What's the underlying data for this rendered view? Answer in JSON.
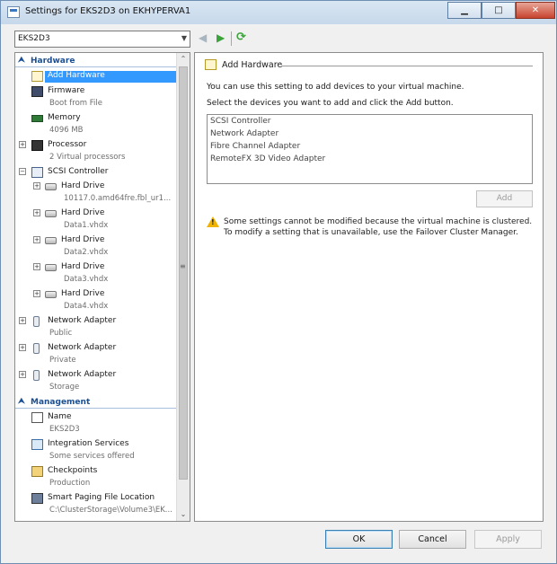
{
  "window": {
    "title": "Settings for EKS2D3 on EKHYPERVA1"
  },
  "vm_selector": {
    "value": "EKS2D3"
  },
  "tree": {
    "hardware_header": "Hardware",
    "hardware": [
      {
        "label": "Add Hardware",
        "sub": ""
      },
      {
        "label": "Firmware",
        "sub": "Boot from File"
      },
      {
        "label": "Memory",
        "sub": "4096 MB"
      },
      {
        "label": "Processor",
        "sub": "2 Virtual processors"
      },
      {
        "label": "SCSI Controller",
        "sub": ""
      },
      {
        "label": "Hard Drive",
        "sub": "10117.0.amd64fre.fbl_ur1..."
      },
      {
        "label": "Hard Drive",
        "sub": "Data1.vhdx"
      },
      {
        "label": "Hard Drive",
        "sub": "Data2.vhdx"
      },
      {
        "label": "Hard Drive",
        "sub": "Data3.vhdx"
      },
      {
        "label": "Hard Drive",
        "sub": "Data4.vhdx"
      },
      {
        "label": "Network Adapter",
        "sub": "Public"
      },
      {
        "label": "Network Adapter",
        "sub": "Private"
      },
      {
        "label": "Network Adapter",
        "sub": "Storage"
      }
    ],
    "management_header": "Management",
    "management": [
      {
        "label": "Name",
        "sub": "EKS2D3"
      },
      {
        "label": "Integration Services",
        "sub": "Some services offered"
      },
      {
        "label": "Checkpoints",
        "sub": "Production"
      },
      {
        "label": "Smart Paging File Location",
        "sub": "C:\\ClusterStorage\\Volume3\\EK..."
      }
    ]
  },
  "panel": {
    "header": "Add Hardware",
    "intro": "You can use this setting to add devices to your virtual machine.",
    "instruction": "Select the devices you want to add and click the Add button.",
    "devices": [
      "SCSI Controller",
      "Network Adapter",
      "Fibre Channel Adapter",
      "RemoteFX 3D Video Adapter"
    ],
    "add_label": "Add",
    "warning": "Some settings cannot be modified because the virtual machine is clustered. To modify a setting that is unavailable, use the Failover Cluster Manager."
  },
  "footer": {
    "ok": "OK",
    "cancel": "Cancel",
    "apply": "Apply"
  },
  "colors": {
    "selection": "#3399ff",
    "section_header": "#1b4f93",
    "close_button": "#c7442e"
  }
}
